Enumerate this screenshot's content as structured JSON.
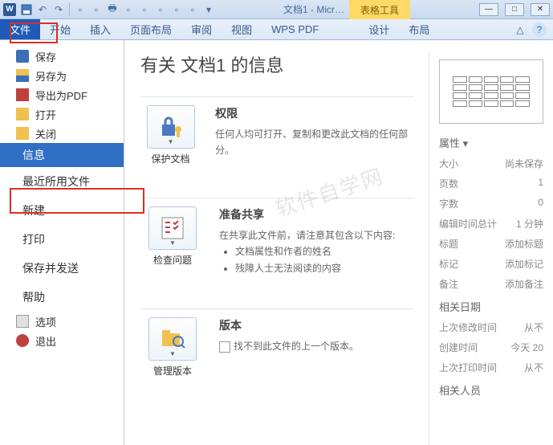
{
  "titleBar": {
    "appGlyph": "W",
    "docTitle": "文档1 - Micr…"
  },
  "contextTab": "表格工具",
  "tabs": {
    "file": "文件",
    "home": "开始",
    "insert": "插入",
    "layout": "页面布局",
    "review": "审阅",
    "view": "视图",
    "wpspdf": "WPS PDF",
    "design": "设计",
    "tblLayout": "布局"
  },
  "sideNav": {
    "save": "保存",
    "saveAs": "另存为",
    "exportPdf": "导出为PDF",
    "open": "打开",
    "close": "关闭",
    "info": "信息",
    "recent": "最近所用文件",
    "new": "新建",
    "print": "打印",
    "saveSend": "保存并发送",
    "help": "帮助",
    "options": "选项",
    "exit": "退出"
  },
  "info": {
    "title": "有关 文档1 的信息",
    "protect": {
      "btn": "保护文档",
      "head": "权限",
      "body": "任何人均可打开、复制和更改此文档的任何部分。"
    },
    "check": {
      "btn": "检查问题",
      "head": "准备共享",
      "body": "在共享此文件前，请注意其包含以下内容:",
      "li1": "文档属性和作者的姓名",
      "li2": "残障人士无法阅读的内容"
    },
    "versions": {
      "btn": "管理版本",
      "head": "版本",
      "body": "找不到此文件的上一个版本。"
    }
  },
  "props": {
    "head": "属性",
    "size": {
      "k": "大小",
      "v": "尚未保存"
    },
    "pages": {
      "k": "页数",
      "v": "1"
    },
    "words": {
      "k": "字数",
      "v": "0"
    },
    "editTime": {
      "k": "编辑时间总计",
      "v": "1 分钟"
    },
    "title": {
      "k": "标题",
      "v": "添加标题"
    },
    "tag": {
      "k": "标记",
      "v": "添加标记"
    },
    "remark": {
      "k": "备注",
      "v": "添加备注"
    },
    "datesHead": "相关日期",
    "modified": {
      "k": "上次修改时间",
      "v": "从不"
    },
    "created": {
      "k": "创建时间",
      "v": "今天 20"
    },
    "printed": {
      "k": "上次打印时间",
      "v": "从不"
    },
    "peopleHead": "相关人员"
  },
  "watermark": "软件自学网"
}
